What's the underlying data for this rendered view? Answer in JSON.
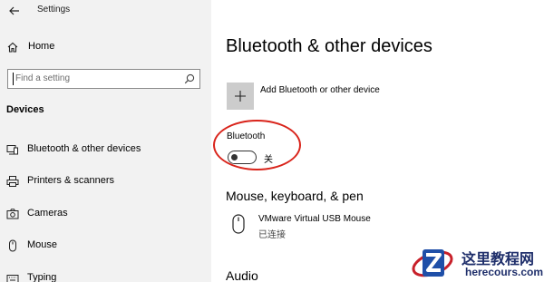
{
  "window": {
    "title": "Settings"
  },
  "sidebar": {
    "home_label": "Home",
    "search_placeholder": "Find a setting",
    "section_label": "Devices",
    "items": [
      {
        "label": "Bluetooth & other devices",
        "icon": "bluetooth-devices-icon"
      },
      {
        "label": "Printers & scanners",
        "icon": "printer-icon"
      },
      {
        "label": "Cameras",
        "icon": "camera-icon"
      },
      {
        "label": "Mouse",
        "icon": "mouse-icon"
      },
      {
        "label": "Typing",
        "icon": "keyboard-icon"
      }
    ]
  },
  "main": {
    "title": "Bluetooth & other devices",
    "add_device_label": "Add Bluetooth or other device",
    "bluetooth": {
      "label": "Bluetooth",
      "state": "关",
      "on": false
    },
    "section_mkp": "Mouse, keyboard, & pen",
    "devices": [
      {
        "name": "VMware Virtual USB Mouse",
        "status": "已连接",
        "icon": "mouse-icon"
      }
    ],
    "section_audio": "Audio"
  },
  "watermark": {
    "text_cn": "这里教程网",
    "text_en": "herecours.com"
  },
  "colors": {
    "sidebar_bg": "#f2f2f2",
    "highlight": "#d9241b",
    "tile_bg": "#cccccc",
    "watermark_text": "#1f2f6b"
  }
}
